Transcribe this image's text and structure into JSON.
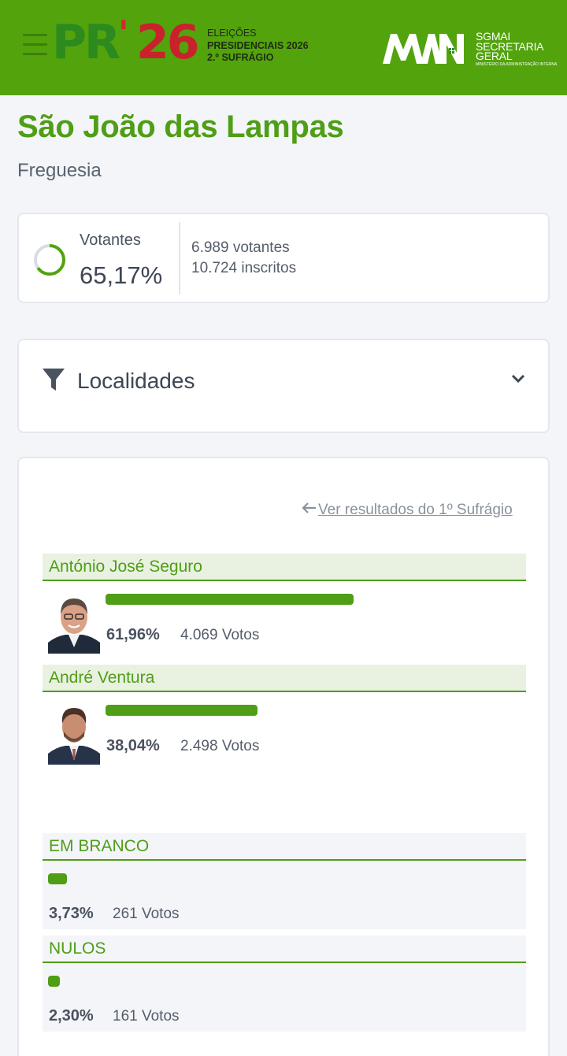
{
  "header": {
    "logo": {
      "pr": "PR",
      "apostrophe": "'",
      "year": "26"
    },
    "logo_sub": [
      "ELEIÇÕES",
      "PRESIDENCIAIS 2026",
      "2.º SUFRÁGIO"
    ],
    "org": {
      "line1": "SGMAI",
      "line2": "SECRETARIA",
      "line3": "GERAL",
      "tagline": "MINISTÉRIO DA ADMINISTRAÇÃO INTERNA"
    },
    "colors": {
      "bar": "#52a30c",
      "pr": "#2c8a1e",
      "year": "#c8222c"
    }
  },
  "page": {
    "title": "São João das Lampas",
    "subtitle": "Freguesia"
  },
  "turnout": {
    "label": "Votantes",
    "percent_text": "65,17%",
    "percent_value": 65.17,
    "voters": "6.989 votantes",
    "registered": "10.724 inscritos"
  },
  "filter": {
    "label": "Localidades",
    "icon": "filter-icon",
    "chevron": "chevron-down-icon"
  },
  "results": {
    "back_link": "Ver resultados do 1º Sufrágio",
    "candidates": [
      {
        "name": "António José Seguro",
        "percent_text": "61,96%",
        "percent_value": 61.96,
        "votes": "4.069 Votos"
      },
      {
        "name": "André Ventura",
        "percent_text": "38,04%",
        "percent_value": 38.04,
        "votes": "2.498 Votos"
      }
    ],
    "others": [
      {
        "name": "EM BRANCO",
        "percent_text": "3,73%",
        "percent_value": 3.73,
        "votes": "261 Votos"
      },
      {
        "name": "NULOS",
        "percent_text": "2,30%",
        "percent_value": 2.3,
        "votes": "161 Votos"
      }
    ],
    "accent": "#4f9e16"
  }
}
